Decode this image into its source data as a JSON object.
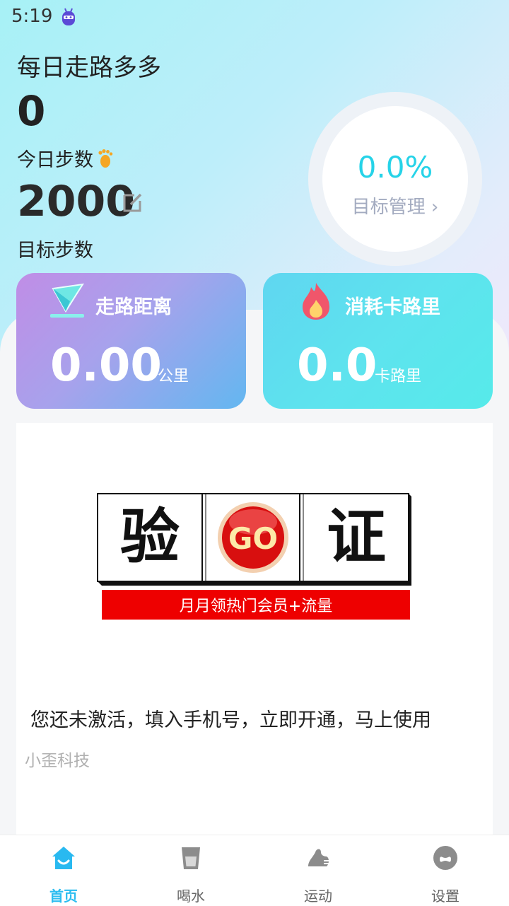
{
  "status": {
    "time": "5:19",
    "app_icon": "robot-icon"
  },
  "header": {
    "title": "每日走路多多",
    "today_steps_value": "0",
    "today_steps_label": "今日步数",
    "goal_steps_value": "2000",
    "goal_steps_label": "目标步数"
  },
  "ring": {
    "percent_text": "0.0%",
    "link_label": "目标管理 ›",
    "progress_fraction": 0.0
  },
  "cards": {
    "distance": {
      "title": "走路距离",
      "value": "0.00",
      "unit": "公里",
      "icon": "paper-plane-icon"
    },
    "calories": {
      "title": "消耗卡路里",
      "value": "0.0",
      "unit": "卡路里",
      "icon": "flame-icon"
    }
  },
  "ad": {
    "banner": {
      "left": "验",
      "center": "GO",
      "right": "证",
      "subtitle": "月月领热门会员+流量"
    },
    "text": "您还未激活，填入手机号，立即开通，马上使用",
    "brand": "小歪科技"
  },
  "nav": [
    {
      "label": "首页",
      "icon": "home-icon",
      "active": true
    },
    {
      "label": "喝水",
      "icon": "cup-icon",
      "active": false
    },
    {
      "label": "运动",
      "icon": "sneaker-icon",
      "active": false
    },
    {
      "label": "设置",
      "icon": "settings-icon",
      "active": false
    }
  ],
  "colors": {
    "accent": "#2cbdf0",
    "ring_text": "#26d3e8",
    "banner_red": "#e3000b"
  }
}
